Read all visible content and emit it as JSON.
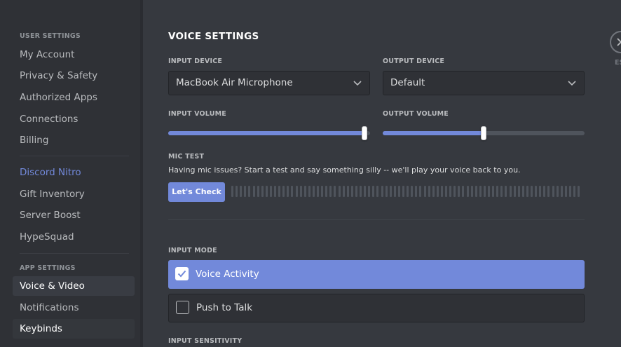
{
  "sidebar": {
    "user_settings_header": "USER SETTINGS",
    "user_items": [
      {
        "label": "My Account"
      },
      {
        "label": "Privacy & Safety"
      },
      {
        "label": "Authorized Apps"
      },
      {
        "label": "Connections"
      },
      {
        "label": "Billing"
      }
    ],
    "nitro_items": [
      {
        "label": "Discord Nitro"
      },
      {
        "label": "Gift Inventory"
      },
      {
        "label": "Server Boost"
      },
      {
        "label": "HypeSquad"
      }
    ],
    "app_settings_header": "APP SETTINGS",
    "app_items": [
      {
        "label": "Voice & Video",
        "selected": true
      },
      {
        "label": "Notifications"
      },
      {
        "label": "Keybinds"
      }
    ]
  },
  "main": {
    "title": "VOICE SETTINGS",
    "input_device": {
      "label": "INPUT DEVICE",
      "value": "MacBook Air Microphone"
    },
    "output_device": {
      "label": "OUTPUT DEVICE",
      "value": "Default"
    },
    "input_volume": {
      "label": "INPUT VOLUME",
      "level": 1.0
    },
    "output_volume": {
      "label": "OUTPUT VOLUME",
      "level": 0.5
    },
    "mic_test": {
      "label": "MIC TEST",
      "description": "Having mic issues? Start a test and say something silly -- we'll play your voice back to you.",
      "button_label": "Let's Check"
    },
    "input_mode": {
      "label": "INPUT MODE",
      "options": [
        {
          "label": "Voice Activity",
          "selected": true
        },
        {
          "label": "Push to Talk",
          "selected": false
        }
      ]
    },
    "input_sensitivity_label": "INPUT SENSITIVITY",
    "close_label": "ES"
  },
  "colors": {
    "accent": "#7289da",
    "background": "#36393f",
    "sidebar": "#2f3136"
  },
  "icons": {
    "chevron": "chevron-down-icon",
    "close": "close-icon",
    "check": "checkmark-icon"
  }
}
